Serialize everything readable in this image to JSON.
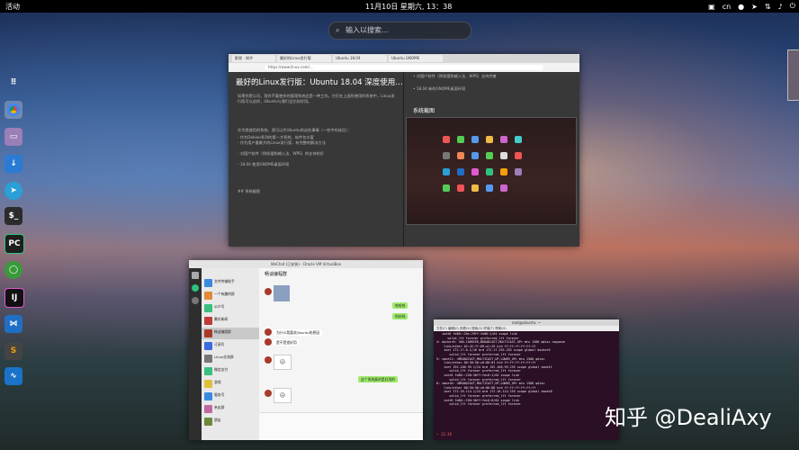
{
  "topbar": {
    "activities": "活动",
    "clock": "11月10日 星期六, 13：38",
    "tray": [
      "cn"
    ]
  },
  "search": {
    "placeholder": "输入以搜索…"
  },
  "dock": [
    "apps-grid",
    "chrome",
    "files",
    "software-updater",
    "telegram",
    "terminal",
    "pycharm",
    "anaconda",
    "intellij",
    "vscode",
    "sublime",
    "system-monitor"
  ],
  "browser": {
    "tabs": [
      "影视 - 知乎",
      "最好的Linux发行版",
      "Ubuntu 18.04",
      "Ubuntu GNOME"
    ],
    "url": "https://www.linux.com/...",
    "title": "最好的Linux发行版：Ubuntu 18.04 深度使用…",
    "paragraphs": [
      "如果你是公司，我作不要使你的管理系统还是一种工作。它们在上面所使用的系统中，Linux发行版可以这样，Ubuntu与我们会比较好用。",
      "作为我使用的系统，我可以为Ubuntu的这些事情（一些中的成员）：",
      "- 作为Debian系列的第一大系统，软件包丰富",
      "- 作为用户量最大的Linux发行版，有完整的解决方法",
      "- 对国产软件（例如搜狗输入法、WPS）的支持较好",
      "- 18.04 使用GNOME桌面环境",
      "## 系统截图"
    ],
    "right_list": [
      "• 对国产软件（例如搜狗输入法、WPS）支持完善",
      "• 18.04 新的GNOME桌面环境"
    ],
    "right_heading": "系统截图"
  },
  "wechat": {
    "title": "WeChat (已安装) - Oracle VM VirtualBox",
    "chat_title": "畅谈编程群",
    "contacts": [
      "文件传输助手",
      "一个有趣的群",
      "公众号",
      "腾讯新闻",
      "畅谈编程群",
      "订阅号",
      "Linux交流群",
      "微信支付",
      "游戏",
      "服务号",
      "亲友群",
      "朋友"
    ],
    "messages": [
      {
        "side": "right",
        "text": "哈哈哈"
      },
      {
        "side": "right",
        "text": "你好呀"
      },
      {
        "side": "left",
        "text": "为什么我喜欢Ubuntu的原因"
      },
      {
        "side": "left",
        "text": "是不是很好用"
      },
      {
        "side": "right",
        "text": "这个系统真的是好用的"
      }
    ]
  },
  "terminal": {
    "title": "root@ubuntu: ~",
    "menu": "文件(F)  编辑(E)  查看(V)  搜索(S)  终端(T)  帮助(H)",
    "lines": [
      "   inet6 fe80::20c:29ff:fe00:1/64 scope link",
      "      valid_lft forever preferred_lft forever",
      "4: docker0: <NO-CARRIER,BROADCAST,MULTICAST,UP> mtu 1500 qdisc noqueue",
      "    link/ether 02:42:7f:69:a1:29 brd ff:ff:ff:ff:ff:ff",
      "    inet 172.17.0.1/16 brd 172.17.255.255 scope global docker0",
      "       valid_lft forever preferred_lft forever",
      "5: vmnet1: <BROADCAST,MULTICAST,UP,LOWER_UP> mtu 1500 qdisc",
      "    link/ether 00:50:56:c0:00:01 brd ff:ff:ff:ff:ff:ff",
      "    inet 192.168.99.1/24 brd 192.168.99.255 scope global vmnet1",
      "       valid_lft forever preferred_lft forever",
      "    inet6 fe80::250:56ff:fec0:1/64 scope link",
      "       valid_lft forever preferred_lft forever",
      "6: vmnet8: <BROADCAST,MULTICAST,UP,LOWER_UP> mtu 1500 qdisc",
      "    link/ether 00:50:56:c0:00:08 brd ff:ff:ff:ff:ff:ff",
      "    inet 172.16.114.1/24 brd 172.16.114.255 scope global vmnet8",
      "       valid_lft forever preferred_lft forever",
      "    inet6 fe80::250:56ff:fec0:8/64 scope link",
      "       valid_lft forever preferred_lft forever"
    ],
    "prompt": "~ 13:38"
  },
  "watermark": "知乎 @DealiAxy"
}
